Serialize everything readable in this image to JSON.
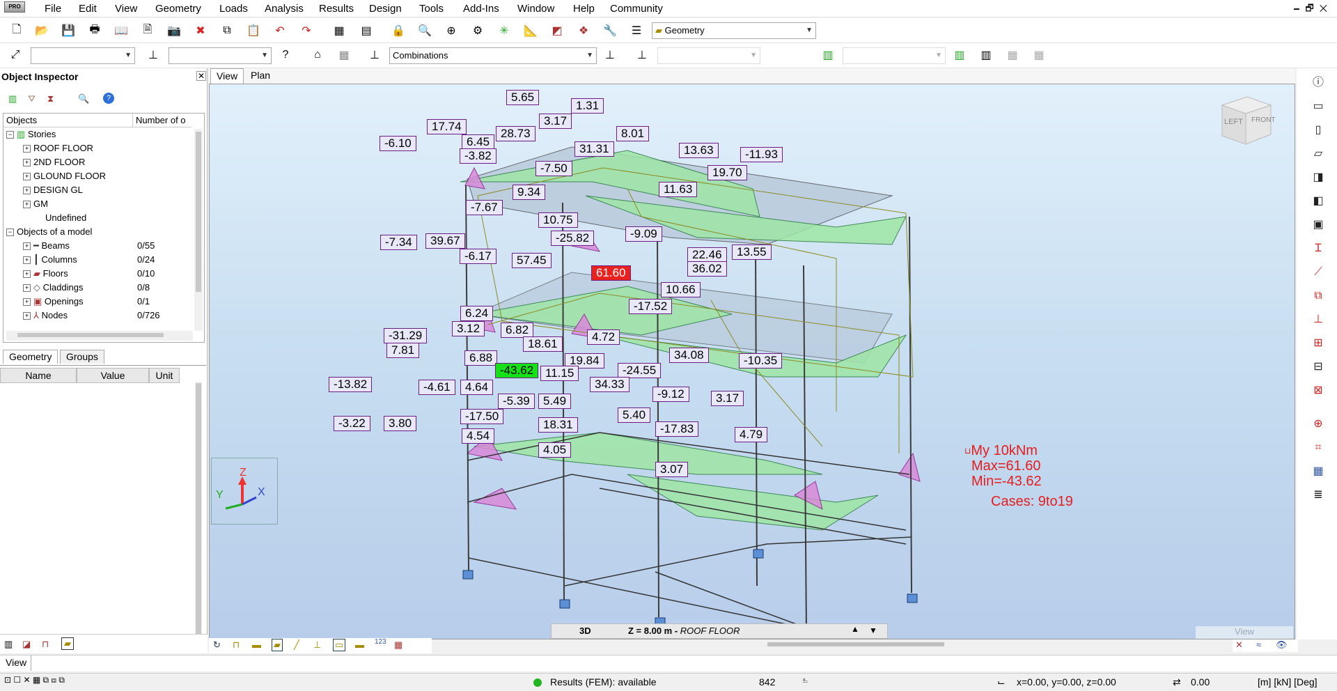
{
  "app": {
    "logo_text": "PRO"
  },
  "menu": [
    "File",
    "Edit",
    "View",
    "Geometry",
    "Loads",
    "Analysis",
    "Results",
    "Design",
    "Tools",
    "Add-Ins",
    "Window",
    "Help",
    "Community"
  ],
  "toolbar": {
    "view_mode": "Geometry",
    "combinations": "Combinations"
  },
  "inspector": {
    "title": "Object Inspector",
    "col_objects": "Objects",
    "col_number": "Number of o",
    "stories_label": "Stories",
    "stories": [
      "ROOF FLOOR",
      "2ND FLOOR",
      "GLOUND FLOOR",
      "DESIGN GL",
      "GM",
      "Undefined"
    ],
    "model_label": "Objects of a model",
    "objects": [
      {
        "name": "Beams",
        "count": "0/55"
      },
      {
        "name": "Columns",
        "count": "0/24"
      },
      {
        "name": "Floors",
        "count": "0/10"
      },
      {
        "name": "Claddings",
        "count": "0/8"
      },
      {
        "name": "Openings",
        "count": "0/1"
      },
      {
        "name": "Nodes",
        "count": "0/726"
      }
    ],
    "tabs": [
      "Geometry",
      "Groups"
    ],
    "prop_headers": [
      "Name",
      "Value",
      "Unit"
    ]
  },
  "viewport": {
    "tabs": [
      "View",
      "Plan"
    ],
    "view_cube": {
      "left": "LEFT",
      "front": "FRONT"
    },
    "axis": {
      "z": "Z",
      "y": "Y",
      "x": "X"
    },
    "labels": [
      "6.45",
      "5.65",
      "1.31",
      "17.74",
      "28.73",
      "3.17",
      "8.01",
      "-6.10",
      "-3.82",
      "31.31",
      "13.63",
      "-11.93",
      "-7.50",
      "19.70",
      "9.34",
      "11.63",
      "-7.67",
      "10.75",
      "-9.09",
      "-7.34",
      "39.67",
      "-25.82",
      "-6.17",
      "57.45",
      "61.60",
      "22.46",
      "13.55",
      "36.02",
      "10.66",
      "-17.52",
      "6.24",
      "-31.29",
      "3.12",
      "6.82",
      "4.72",
      "7.81",
      "18.61",
      "34.08",
      "6.88",
      "19.84",
      "-43.62",
      "11.15",
      "-24.55",
      "-10.35",
      "-13.82",
      "-4.61",
      "4.64",
      "34.33",
      "-9.12",
      "3.17",
      "-5.39",
      "5.49",
      "-17.50",
      "5.40",
      "-3.22",
      "3.80",
      "18.31",
      "-17.83",
      "4.54",
      "4.79",
      "4.05",
      "3.07"
    ],
    "max_label": "61.60",
    "min_label": "-43.62",
    "legend": {
      "line1": "My  10kNm",
      "line2": "Max=61.60",
      "line3": "Min=-43.62",
      "cases": "Cases: 9to19"
    },
    "bottom": {
      "mode": "3D",
      "level": "Z = 8.00 m - ",
      "level_name": "ROOF FLOOR",
      "view_hint": "View"
    }
  },
  "status": {
    "mode": "View",
    "results": "Results (FEM): available",
    "count": "842",
    "coords": "x=0.00, y=0.00, z=0.00",
    "value": "0.00",
    "units": "[m] [kN] [Deg]"
  },
  "colors": {
    "max": "#e8231f",
    "min": "#16e016",
    "label_border": "#6a1d82",
    "legend": "#e41d1d"
  }
}
